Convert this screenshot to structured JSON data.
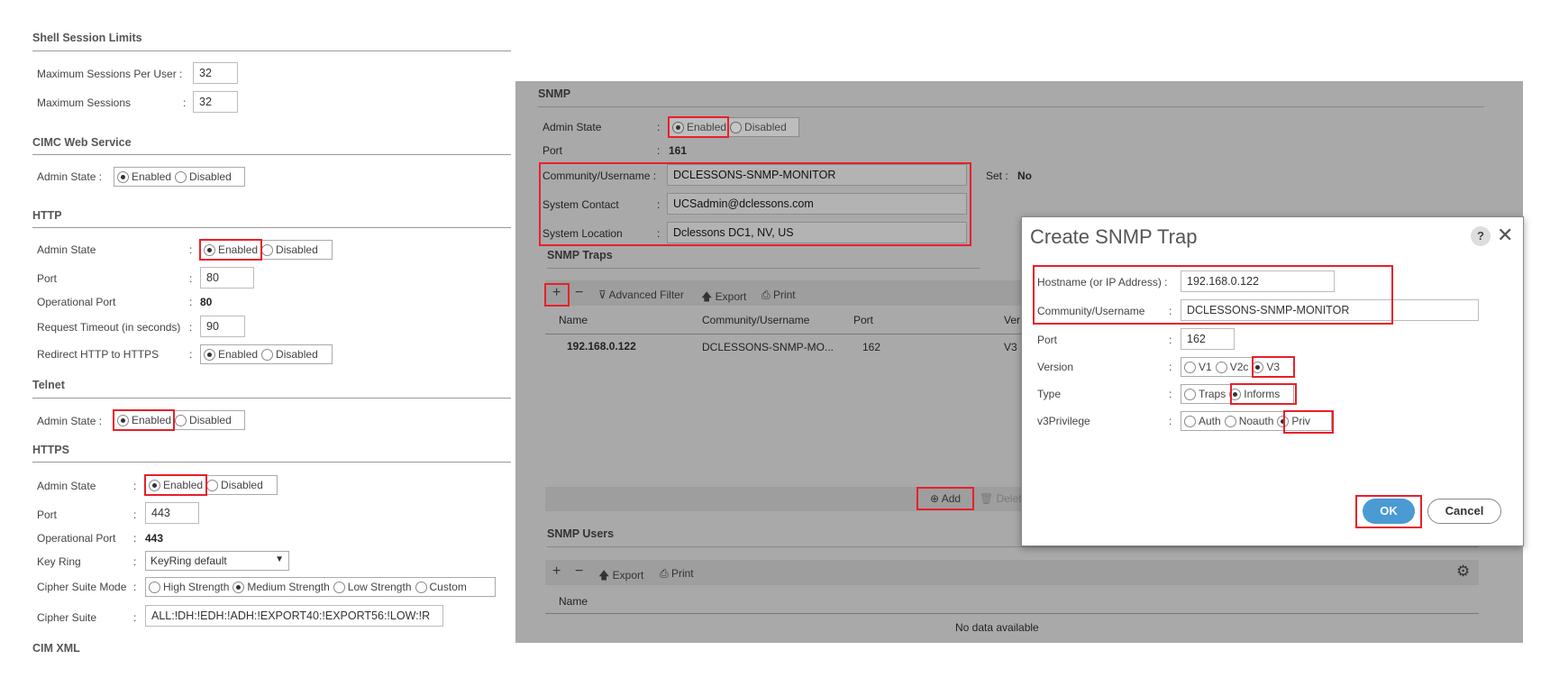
{
  "left": {
    "shell": {
      "title": "Shell Session Limits",
      "max_per_user_label": "Maximum Sessions Per User :",
      "max_per_user_value": "32",
      "max_sessions_label": "Maximum Sessions",
      "max_sessions_value": "32"
    },
    "cimc": {
      "title": "CIMC Web Service",
      "admin_state_label": "Admin State :",
      "enabled": "Enabled",
      "disabled": "Disabled"
    },
    "http": {
      "title": "HTTP",
      "admin_state_label": "Admin State",
      "enabled": "Enabled",
      "disabled": "Disabled",
      "port_label": "Port",
      "port_value": "80",
      "op_port_label": "Operational Port",
      "op_port_value": "80",
      "timeout_label": "Request Timeout (in seconds)",
      "timeout_value": "90",
      "redirect_label": "Redirect HTTP to HTTPS",
      "redirect_enabled": "Enabled",
      "redirect_disabled": "Disabled"
    },
    "telnet": {
      "title": "Telnet",
      "admin_state_label": "Admin State :",
      "enabled": "Enabled",
      "disabled": "Disabled"
    },
    "https": {
      "title": "HTTPS",
      "admin_state_label": "Admin State",
      "enabled": "Enabled",
      "disabled": "Disabled",
      "port_label": "Port",
      "port_value": "443",
      "op_port_label": "Operational Port",
      "op_port_value": "443",
      "keyring_label": "Key Ring",
      "keyring_value": "KeyRing default",
      "cipher_mode_label": "Cipher Suite Mode",
      "cipher_modes": [
        "High Strength",
        "Medium Strength",
        "Low Strength",
        "Custom"
      ],
      "cipher_suite_label": "Cipher Suite",
      "cipher_suite_value": "ALL:!DH:!EDH:!ADH:!EXPORT40:!EXPORT56:!LOW:!R"
    },
    "cimxml": {
      "title": "CIM XML"
    }
  },
  "snmp": {
    "title": "SNMP",
    "admin_state_label": "Admin State",
    "enabled": "Enabled",
    "disabled": "Disabled",
    "port_label": "Port",
    "port_value": "161",
    "community_label": "Community/Username :",
    "community_value": "DCLESSONS-SNMP-MONITOR",
    "set_label": "Set :",
    "set_value": "No",
    "contact_label": "System Contact",
    "contact_value": "UCSadmin@dclessons.com",
    "location_label": "System Location",
    "location_value": "Dclessons DC1, NV, US",
    "traps": {
      "title": "SNMP Traps",
      "toolbar": {
        "add": "+",
        "remove": "−",
        "filter": "Advanced Filter",
        "export": "Export",
        "print": "Print"
      },
      "columns": [
        "Name",
        "Community/Username",
        "Port",
        "Ver"
      ],
      "rows": [
        {
          "name": "192.168.0.122",
          "community": "DCLESSONS-SNMP-MO...",
          "port": "162",
          "ver": "V3"
        }
      ],
      "add_label": "Add",
      "delete_label": "Delet"
    },
    "users": {
      "title": "SNMP Users",
      "toolbar": {
        "add": "+",
        "remove": "−",
        "export": "Export",
        "print": "Print"
      },
      "columns": [
        "Name"
      ],
      "empty": "No data available"
    }
  },
  "dialog": {
    "title": "Create SNMP Trap",
    "help": "?",
    "close": "✕",
    "hostname_label": "Hostname (or IP Address) :",
    "hostname_value": "192.168.0.122",
    "community_label": "Community/Username",
    "community_value": "DCLESSONS-SNMP-MONITOR",
    "port_label": "Port",
    "port_value": "162",
    "version_label": "Version",
    "versions": [
      "V1",
      "V2c",
      "V3"
    ],
    "type_label": "Type",
    "types": [
      "Traps",
      "Informs"
    ],
    "priv_label": "v3Privilege",
    "privs": [
      "Auth",
      "Noauth",
      "Priv"
    ],
    "ok": "OK",
    "cancel": "Cancel"
  },
  "colors": {
    "highlight": "#e8202a",
    "ok_button": "#4a9ad4",
    "panel_gray": "#a9a9a9"
  }
}
